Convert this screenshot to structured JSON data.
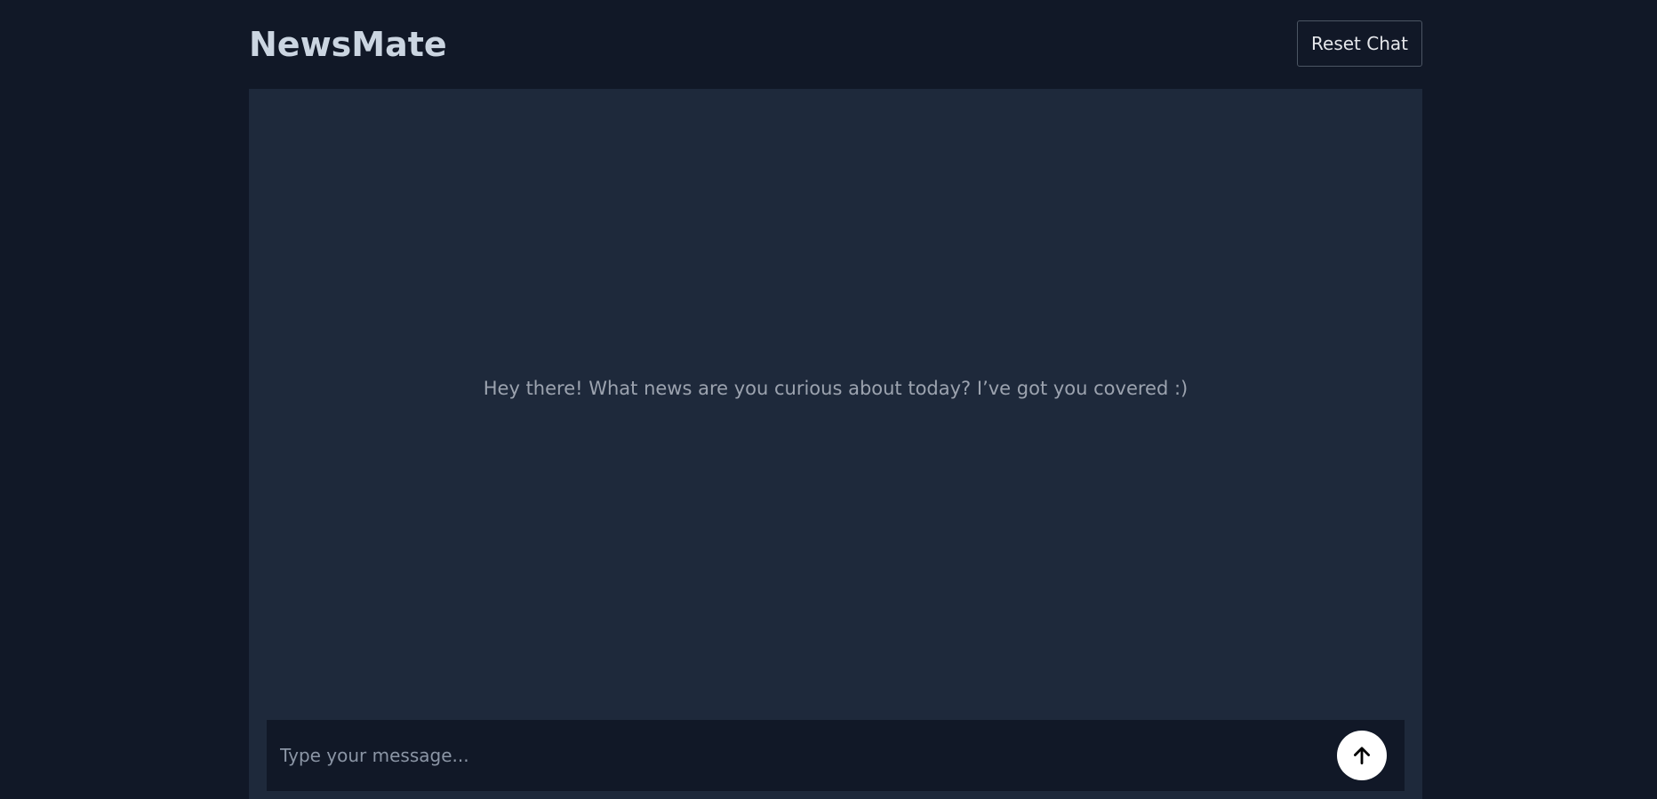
{
  "header": {
    "brand": "NewsMate",
    "reset_label": "Reset Chat"
  },
  "chat": {
    "welcome_message": "Hey there! What news are you curious about today? I’ve got you covered :)"
  },
  "composer": {
    "placeholder": "Type your message...",
    "value": "",
    "send_icon": "arrow-up-icon"
  },
  "colors": {
    "page_background": "#111827",
    "panel_background": "#1e293b",
    "composer_background": "#111827",
    "send_button": "#ffffff"
  }
}
